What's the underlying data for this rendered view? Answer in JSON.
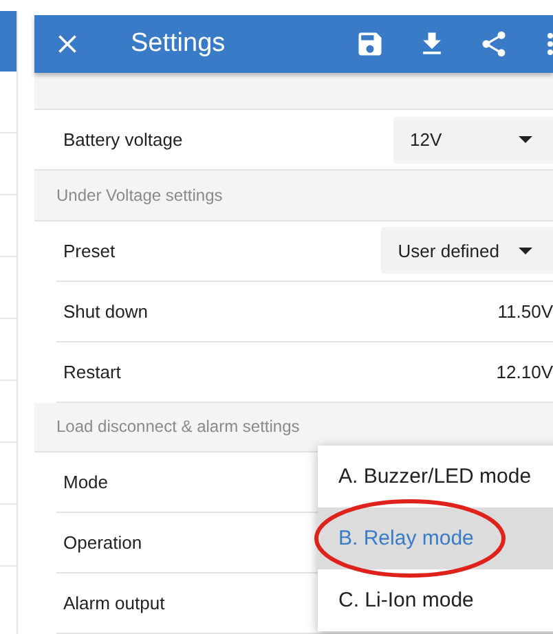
{
  "app_bar": {
    "title": "Settings"
  },
  "rows": [
    {
      "kind": "select",
      "label": "Battery voltage",
      "value": "12V"
    },
    {
      "kind": "header",
      "label": "Under Voltage settings"
    },
    {
      "kind": "select",
      "label": "Preset",
      "value": "User defined"
    },
    {
      "kind": "value",
      "label": "Shut down",
      "value": "11.50V"
    },
    {
      "kind": "value",
      "label": "Restart",
      "value": "12.10V"
    },
    {
      "kind": "header",
      "label": "Load disconnect & alarm settings"
    },
    {
      "kind": "plain",
      "label": "Mode"
    },
    {
      "kind": "plain",
      "label": "Operation"
    },
    {
      "kind": "plain",
      "label": "Alarm output"
    }
  ],
  "menu": {
    "items": [
      {
        "label": "A. Buzzer/LED mode",
        "selected": false,
        "circled": false
      },
      {
        "label": "B. Relay mode",
        "selected": true,
        "circled": true
      },
      {
        "label": "C. Li-Ion mode",
        "selected": false,
        "circled": false
      }
    ]
  }
}
